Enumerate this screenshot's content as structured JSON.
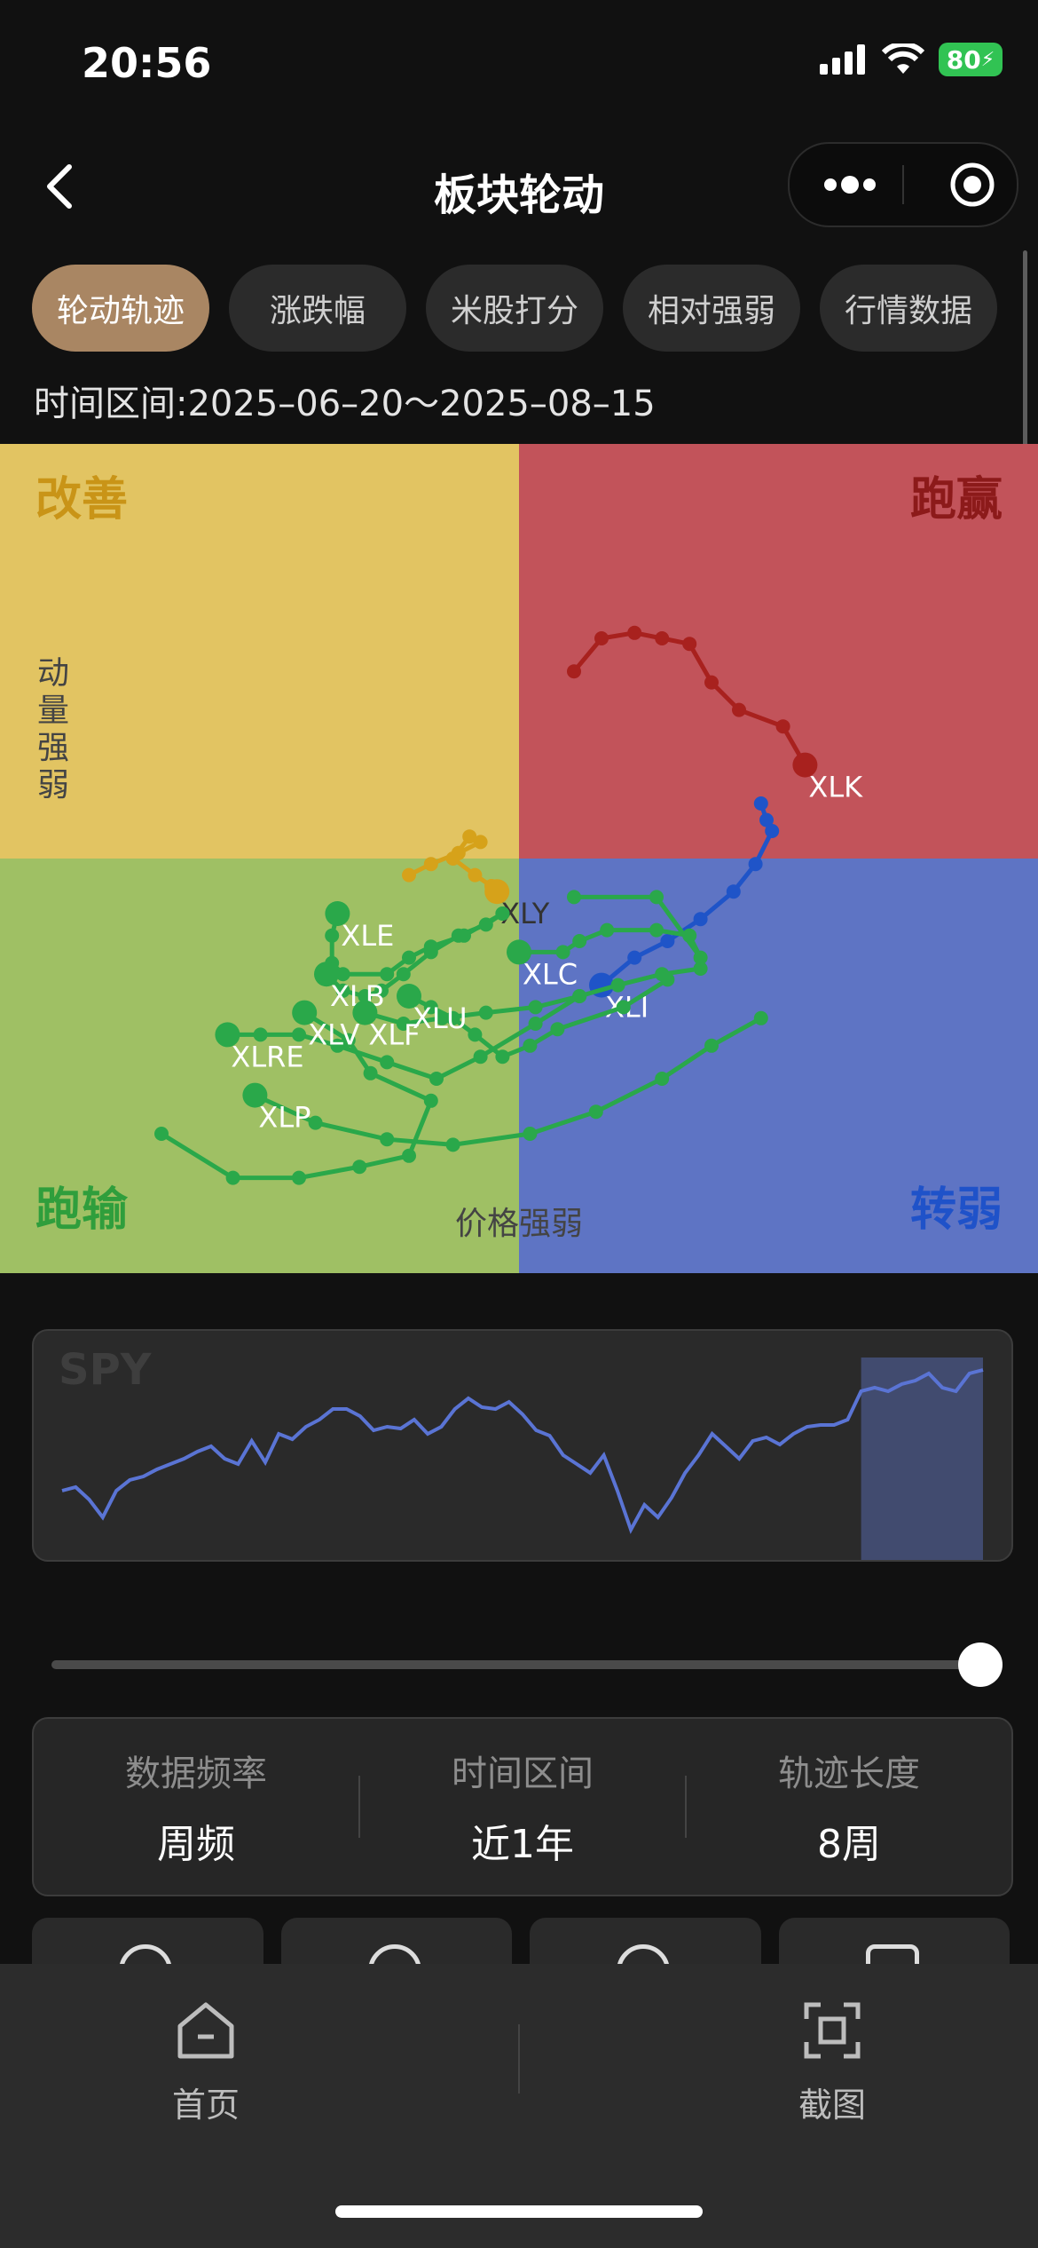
{
  "status": {
    "time": "20:56",
    "battery": "80"
  },
  "nav": {
    "title": "板块轮动"
  },
  "tabs": [
    {
      "label": "轮动轨迹",
      "active": true
    },
    {
      "label": "涨跌幅",
      "active": false
    },
    {
      "label": "米股打分",
      "active": false
    },
    {
      "label": "相对强弱",
      "active": false
    },
    {
      "label": "行情数据",
      "active": false
    }
  ],
  "time_range": "时间区间:2025–06–20～2025–08–15",
  "rrg": {
    "quadrants": {
      "improving": {
        "label": "改善",
        "color": "#e2c462",
        "text_color": "#c99417"
      },
      "leading": {
        "label": "跑赢",
        "color": "#c2535a",
        "text_color": "#8c1a1a"
      },
      "lagging": {
        "label": "跑输",
        "color": "#9fc064",
        "text_color": "#2f9e3c"
      },
      "weakening": {
        "label": "转弱",
        "color": "#5e74c4",
        "text_color": "#1f52c9"
      }
    },
    "y_axis_label": "动量强弱",
    "x_axis_label": "价格强弱"
  },
  "chart_data": {
    "type": "scatter",
    "title": "",
    "xlabel": "价格强弱",
    "ylabel": "动量强弱",
    "note": "Relative rotation graph: each series is an 8-week weekly trail, last point = current position",
    "series": [
      {
        "name": "XLK",
        "color": "#a8211e",
        "points": [
          [
            101.0,
            103.4
          ],
          [
            101.5,
            104.0
          ],
          [
            102.1,
            104.1
          ],
          [
            102.6,
            104.0
          ],
          [
            103.1,
            103.9
          ],
          [
            103.5,
            103.2
          ],
          [
            104.0,
            102.7
          ],
          [
            104.8,
            102.4
          ],
          [
            105.2,
            101.7
          ]
        ]
      },
      {
        "name": "XLI",
        "color": "#1f54c8",
        "points": [
          [
            104.4,
            101.0
          ],
          [
            104.5,
            100.7
          ],
          [
            104.6,
            100.5
          ],
          [
            104.3,
            99.9
          ],
          [
            103.9,
            99.4
          ],
          [
            103.3,
            98.9
          ],
          [
            102.7,
            98.5
          ],
          [
            102.1,
            98.2
          ],
          [
            101.5,
            97.7
          ]
        ]
      },
      {
        "name": "XLY",
        "color": "#d6a21a",
        "points": [
          [
            98.0,
            99.7
          ],
          [
            98.4,
            99.9
          ],
          [
            98.9,
            100.1
          ],
          [
            99.3,
            100.3
          ],
          [
            99.1,
            100.4
          ],
          [
            98.8,
            100.0
          ],
          [
            99.2,
            99.7
          ],
          [
            99.5,
            99.5
          ],
          [
            99.6,
            99.4
          ]
        ]
      },
      {
        "name": "XLE",
        "color": "#2aa84a",
        "points": [
          [
            99.7,
            99.0
          ],
          [
            99.0,
            98.6
          ],
          [
            98.4,
            98.4
          ],
          [
            98.0,
            98.2
          ],
          [
            97.6,
            97.9
          ],
          [
            96.8,
            97.9
          ],
          [
            96.6,
            98.1
          ],
          [
            96.6,
            98.6
          ],
          [
            96.7,
            99.0
          ]
        ]
      },
      {
        "name": "XLC",
        "color": "#2aa84a",
        "points": [
          [
            101.0,
            99.3
          ],
          [
            102.5,
            99.3
          ],
          [
            103.3,
            98.2
          ],
          [
            103.1,
            98.6
          ],
          [
            102.5,
            98.7
          ],
          [
            101.6,
            98.7
          ],
          [
            101.1,
            98.5
          ],
          [
            100.8,
            98.3
          ],
          [
            100.0,
            98.3
          ]
        ]
      },
      {
        "name": "XLB",
        "color": "#2aa84a",
        "points": [
          [
            99.7,
            99.0
          ],
          [
            99.4,
            98.8
          ],
          [
            98.9,
            98.6
          ],
          [
            98.4,
            98.3
          ],
          [
            97.9,
            97.9
          ],
          [
            97.5,
            97.6
          ],
          [
            97.2,
            97.5
          ],
          [
            96.8,
            97.6
          ],
          [
            96.5,
            97.9
          ]
        ]
      },
      {
        "name": "XLF",
        "color": "#2aa84a",
        "points": [
          [
            103.3,
            98.0
          ],
          [
            102.6,
            97.9
          ],
          [
            101.8,
            97.7
          ],
          [
            101.1,
            97.5
          ],
          [
            100.3,
            97.3
          ],
          [
            99.4,
            97.2
          ],
          [
            98.6,
            97.1
          ],
          [
            97.9,
            97.0
          ],
          [
            97.2,
            97.2
          ]
        ]
      },
      {
        "name": "XLU",
        "color": "#2aa84a",
        "points": [
          [
            102.7,
            97.8
          ],
          [
            101.9,
            97.3
          ],
          [
            100.7,
            96.9
          ],
          [
            100.2,
            96.6
          ],
          [
            99.7,
            96.4
          ],
          [
            99.2,
            96.8
          ],
          [
            98.8,
            97.1
          ],
          [
            98.4,
            97.3
          ],
          [
            98.0,
            97.5
          ]
        ]
      },
      {
        "name": "XLRE",
        "color": "#2aa84a",
        "points": [
          [
            101.1,
            97.5
          ],
          [
            100.3,
            97.0
          ],
          [
            99.3,
            96.4
          ],
          [
            98.5,
            96.0
          ],
          [
            97.6,
            96.3
          ],
          [
            96.7,
            96.6
          ],
          [
            96.0,
            96.8
          ],
          [
            95.3,
            96.8
          ],
          [
            94.7,
            96.8
          ]
        ]
      },
      {
        "name": "XLP",
        "color": "#2aa84a",
        "points": [
          [
            104.4,
            97.1
          ],
          [
            103.5,
            96.6
          ],
          [
            102.6,
            96.0
          ],
          [
            101.4,
            95.4
          ],
          [
            100.2,
            95.0
          ],
          [
            98.8,
            94.8
          ],
          [
            97.6,
            94.9
          ],
          [
            96.3,
            95.2
          ],
          [
            95.2,
            95.7
          ]
        ]
      },
      {
        "name": "XLV",
        "color": "#2aa84a",
        "points": [
          [
            93.5,
            95.0
          ],
          [
            94.8,
            94.2
          ],
          [
            96.0,
            94.2
          ],
          [
            97.1,
            94.4
          ],
          [
            98.0,
            94.6
          ],
          [
            98.4,
            95.6
          ],
          [
            97.3,
            96.1
          ],
          [
            96.9,
            96.7
          ],
          [
            96.1,
            97.2
          ]
        ]
      }
    ]
  },
  "spy": {
    "label": "SPY",
    "chart_data": {
      "type": "line",
      "title": "",
      "series": [
        {
          "name": "SPY",
          "values": [
            560,
            562,
            555,
            545,
            560,
            566,
            568,
            572,
            575,
            578,
            582,
            585,
            578,
            575,
            588,
            576,
            592,
            589,
            596,
            600,
            606,
            606,
            602,
            594,
            596,
            595,
            600,
            592,
            596,
            606,
            612,
            607,
            606,
            610,
            603,
            594,
            591,
            580,
            575,
            570,
            580,
            560,
            538,
            552,
            545,
            556,
            570,
            580,
            592,
            585,
            578,
            588,
            590,
            586,
            592,
            596,
            597,
            597,
            600,
            616,
            618,
            616,
            620,
            622,
            626,
            618,
            616,
            626,
            628
          ]
        }
      ],
      "highlight_range": [
        59,
        68
      ],
      "ylim": [
        530,
        635
      ]
    }
  },
  "settings": [
    {
      "label": "数据频率",
      "value": "周频"
    },
    {
      "label": "时间区间",
      "value": "近1年"
    },
    {
      "label": "轨迹长度",
      "value": "8周"
    }
  ],
  "bottom_nav": {
    "home": "首页",
    "screenshot": "截图"
  }
}
